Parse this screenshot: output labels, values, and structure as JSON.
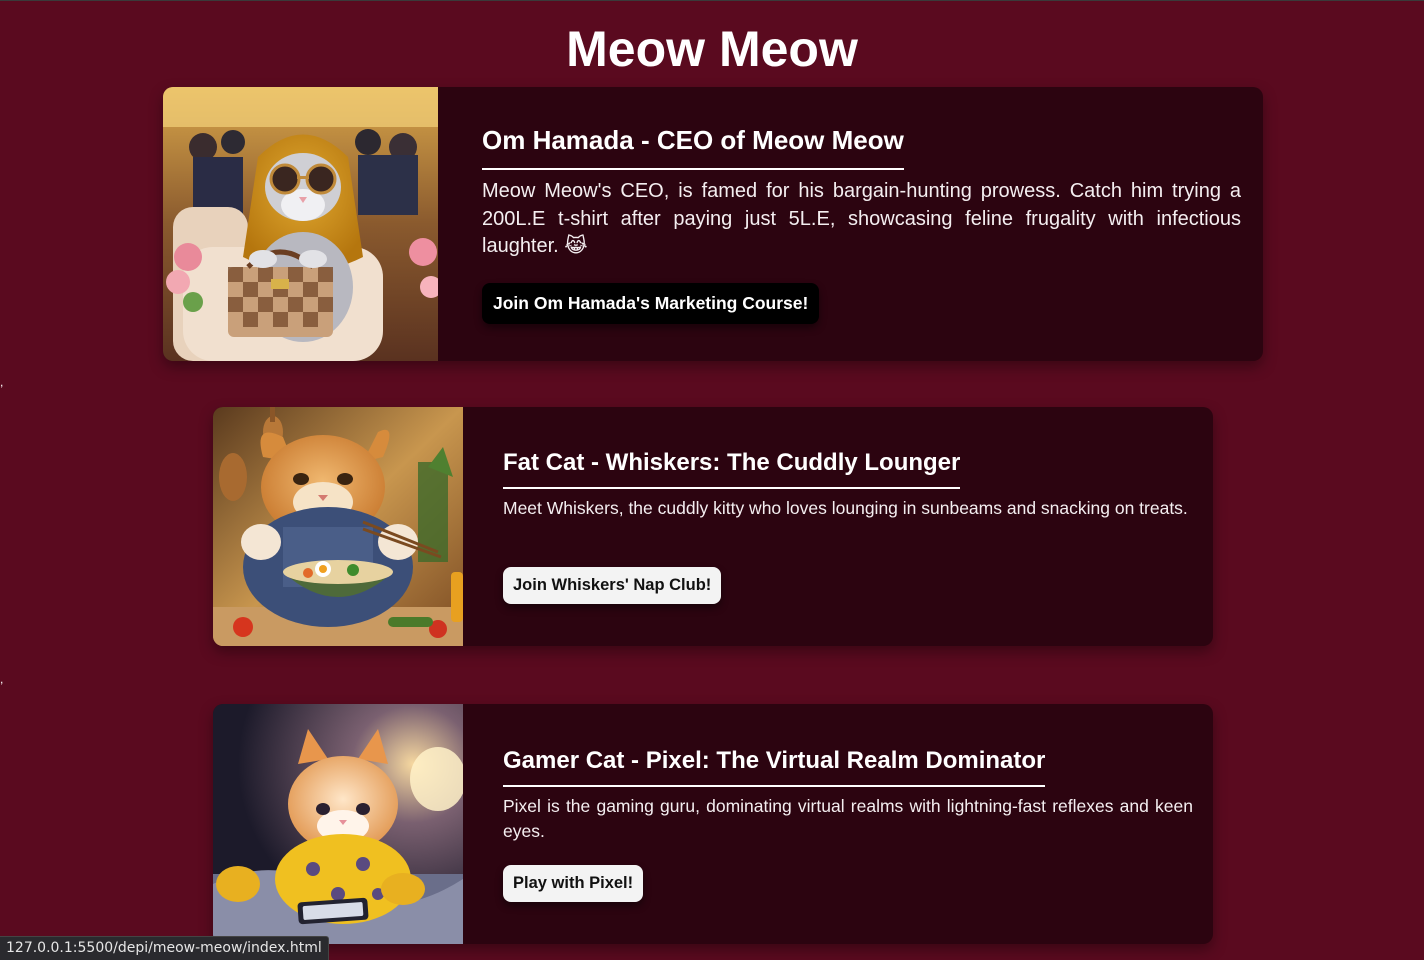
{
  "page": {
    "title": "Meow Meow",
    "background": "#5a0a1f",
    "card_background": "#2c0410"
  },
  "cards": [
    {
      "image_icon": "cat-in-headscarf-with-handbag",
      "heading": "Om Hamada - CEO of Meow Meow",
      "description": "Meow Meow's CEO, is famed for his bargain-hunting prowess. Catch him trying a 200L.E t-shirt after paying just 5L.E, showcasing feline frugality with infectious laughter. 😹",
      "button": "Join Om Hamada's Marketing Course!"
    },
    {
      "image_icon": "fat-cat-eating-noodles",
      "heading": "Fat Cat - Whiskers: The Cuddly Lounger",
      "description": "Meet Whiskers, the cuddly kitty who loves lounging in sunbeams and snacking on treats.",
      "button": "Join Whiskers' Nap Club!"
    },
    {
      "image_icon": "kitten-with-phone",
      "heading": "Gamer Cat - Pixel: The Virtual Realm Dominator",
      "description": "Pixel is the gaming guru, dominating virtual realms with lightning-fast reflexes and keen eyes.",
      "button": "Play with Pixel!"
    }
  ],
  "stray_marks": [
    ",",
    ","
  ],
  "status_bar": {
    "url": "127.0.0.1:5500/depi/meow-meow/index.html"
  }
}
